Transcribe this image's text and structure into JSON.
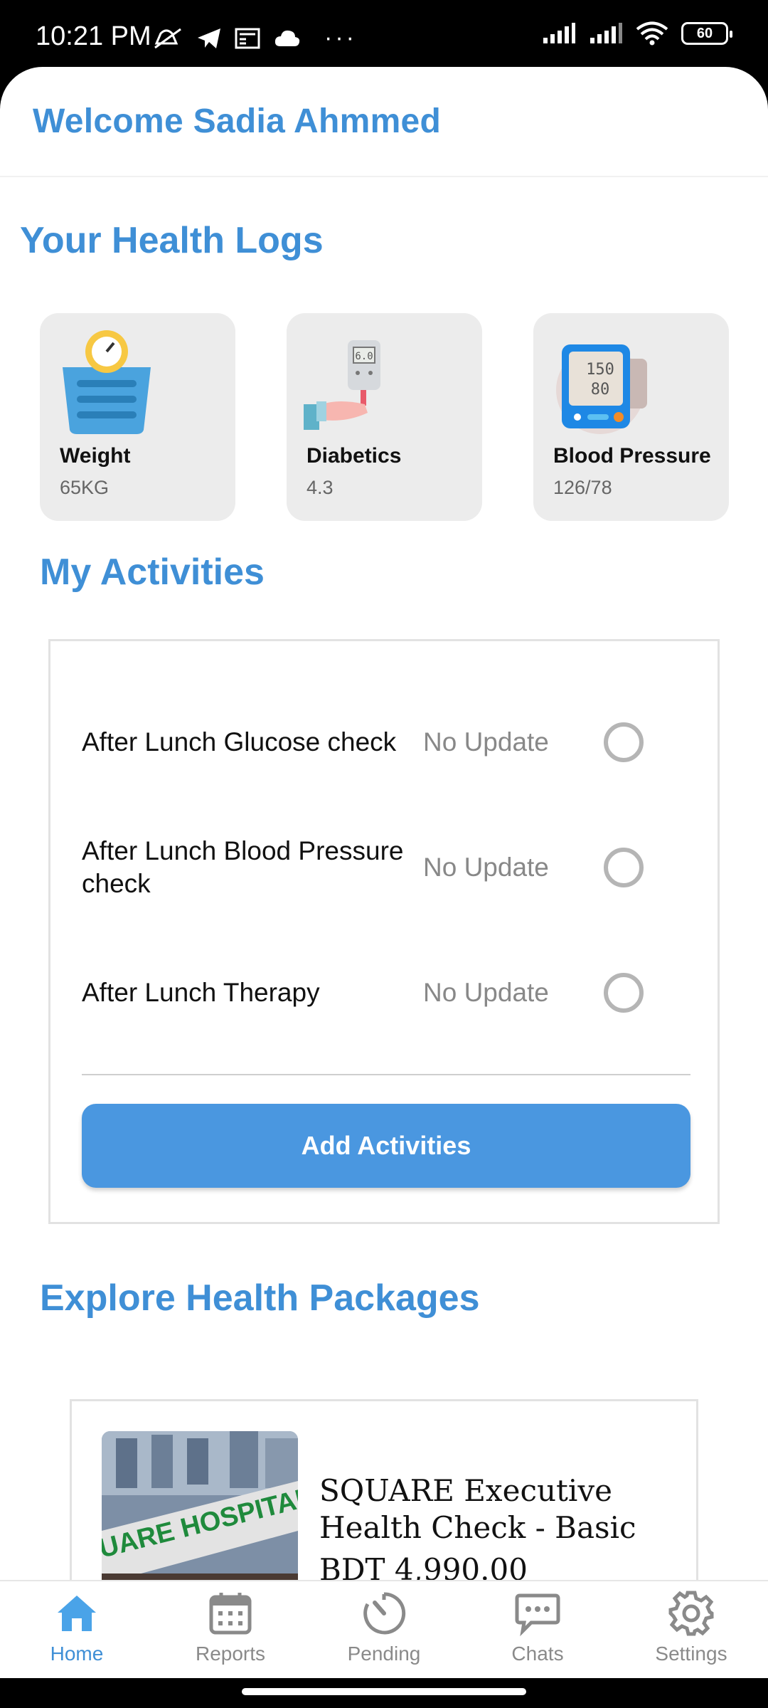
{
  "statusbar": {
    "time": "10:21 PM",
    "battery": "60"
  },
  "header": {
    "welcome": "Welcome Sadia Ahmmed"
  },
  "health_logs": {
    "title": "Your Health Logs",
    "cards": [
      {
        "title": "Weight",
        "value": "65KG",
        "icon": "weight-scale-icon"
      },
      {
        "title": "Diabetics",
        "value": "4.3",
        "icon": "glucose-meter-icon"
      },
      {
        "title": "Blood Pressure",
        "value": "126/78",
        "icon": "blood-pressure-monitor-icon"
      }
    ]
  },
  "activities": {
    "title": "My Activities",
    "items": [
      {
        "name": "After Lunch Glucose check",
        "status": "No Update"
      },
      {
        "name": "After Lunch Blood Pressure check",
        "status": "No Update"
      },
      {
        "name": "After Lunch Therapy",
        "status": "No Update"
      }
    ],
    "add_button": "Add Activities"
  },
  "packages": {
    "title": "Explore Health Packages",
    "items": [
      {
        "name": "SQUARE Executive Health Check - Basic",
        "price": "BDT 4,990.00",
        "image_sign": "UARE HOSPITAL"
      }
    ]
  },
  "nav": {
    "items": [
      {
        "label": "Home",
        "icon": "home-icon",
        "active": true
      },
      {
        "label": "Reports",
        "icon": "calendar-icon",
        "active": false
      },
      {
        "label": "Pending",
        "icon": "gauge-icon",
        "active": false
      },
      {
        "label": "Chats",
        "icon": "chat-bubble-icon",
        "active": false
      },
      {
        "label": "Settings",
        "icon": "gear-icon",
        "active": false
      }
    ]
  },
  "colors": {
    "accent": "#3f8fd6",
    "button": "#4a97e0",
    "card_bg": "#ececec"
  }
}
